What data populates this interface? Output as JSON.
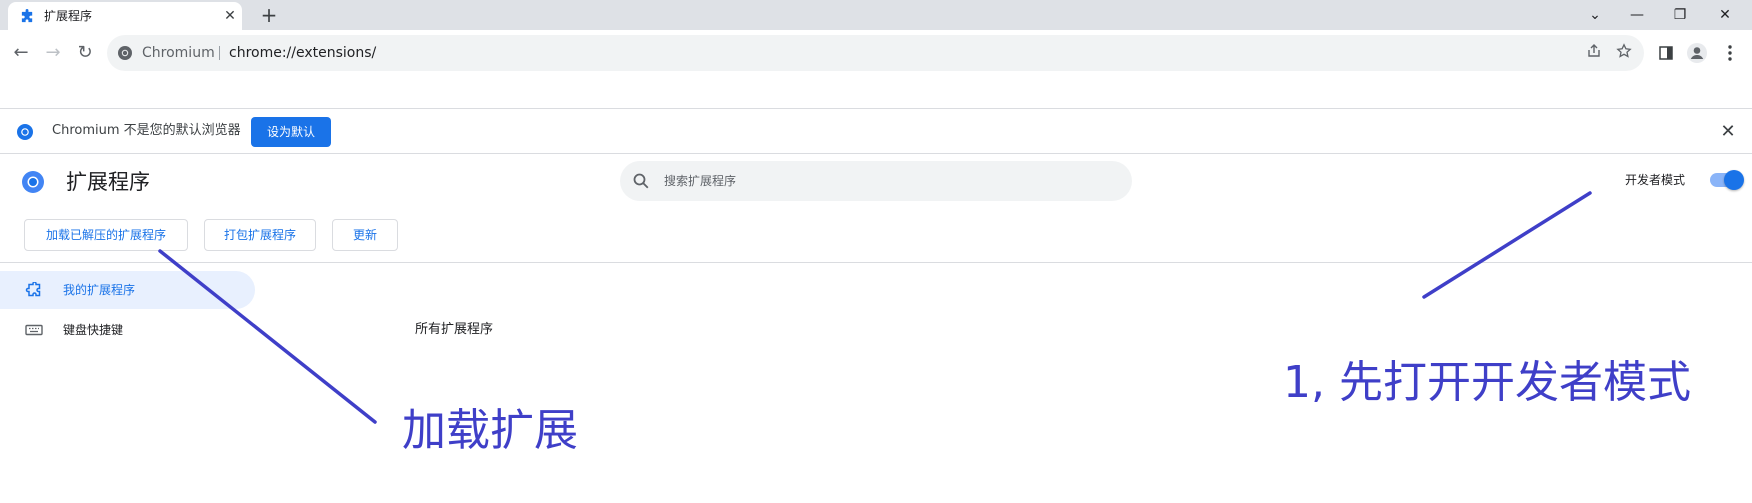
{
  "tab": {
    "title": "扩展程序",
    "close": "✕",
    "new_tab": "+"
  },
  "window_controls": {
    "tab_search": "⌄",
    "minimize": "—",
    "restore": "❐",
    "close": "✕"
  },
  "toolbar": {
    "back": "←",
    "forward": "→",
    "reload": "↻",
    "site_name": "Chromium",
    "url": "chrome://extensions/"
  },
  "infobar": {
    "message": "Chromium 不是您的默认浏览器",
    "button": "设为默认",
    "close": "✕"
  },
  "page": {
    "title": "扩展程序",
    "search_placeholder": "搜索扩展程序",
    "developer_mode_label": "开发者模式",
    "developer_mode_on": true,
    "buttons": {
      "load_unpacked": "加载已解压的扩展程序",
      "pack": "打包扩展程序",
      "update": "更新"
    },
    "sidebar": [
      {
        "label": "我的扩展程序",
        "active": true
      },
      {
        "label": "键盘快捷键",
        "active": false
      }
    ],
    "section_title": "所有扩展程序"
  },
  "annotations": {
    "devmode_note": "1, 先打开开发者模式",
    "load_note": "加载扩展"
  },
  "colors": {
    "accent": "#1a73e8",
    "annotation": "#3f3fc8"
  },
  "icons": {
    "tab": "puzzle-icon",
    "omnibox": "chromium-icon",
    "share": "share-icon",
    "bookmark": "star-icon",
    "side_panel": "side-panel-icon",
    "profile": "profile-icon",
    "menu": "kebab-menu-icon",
    "search": "search-icon",
    "extensions_nav": "extension-icon",
    "shortcuts_nav": "keyboard-icon"
  }
}
